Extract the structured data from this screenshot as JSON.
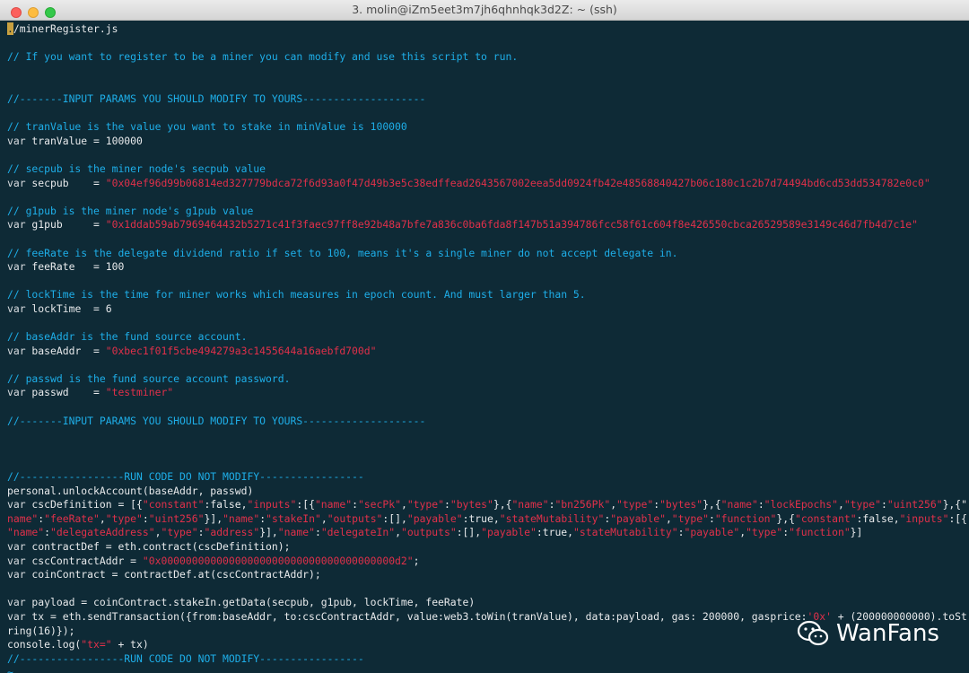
{
  "window": {
    "title": "3. molin@iZm5eet3m7jh6qhnhqk3d2Z: ~ (ssh)",
    "colors": {
      "background": "#0e2a36",
      "comment": "#1eaee8",
      "string": "#e0304a",
      "text": "#e8eaec",
      "cursor": "#c8a040"
    }
  },
  "terminal": {
    "lines": [
      {
        "type": "cursor-line",
        "cursor_char": ".",
        "text": "/minerRegister.js"
      },
      {
        "type": "blank"
      },
      {
        "type": "comment",
        "text": "// If you want to register to be a miner you can modify and use this script to run."
      },
      {
        "type": "blank"
      },
      {
        "type": "blank"
      },
      {
        "type": "comment",
        "text": "//-------INPUT PARAMS YOU SHOULD MODIFY TO YOURS--------------------"
      },
      {
        "type": "blank"
      },
      {
        "type": "comment",
        "text": "// tranValue is the value you want to stake in minValue is 100000"
      },
      {
        "type": "code",
        "parts": [
          {
            "k": "var",
            "t": "var"
          },
          {
            "t": " tranValue = 100000"
          }
        ]
      },
      {
        "type": "blank"
      },
      {
        "type": "comment",
        "text": "// secpub is the miner node's secpub value"
      },
      {
        "type": "code",
        "parts": [
          {
            "k": "var",
            "t": "var"
          },
          {
            "t": " secpub    = "
          },
          {
            "k": "str",
            "t": "\"0x04ef96d99b06814ed327779bdca72f6d93a0f47d49b3e5c38edffead2643567002eea5dd0924fb42e48568840427b06c180c1c2b7d74494bd6cd53dd534782e0c0\""
          }
        ]
      },
      {
        "type": "blank"
      },
      {
        "type": "comment",
        "text": "// g1pub is the miner node's g1pub value"
      },
      {
        "type": "code",
        "parts": [
          {
            "k": "var",
            "t": "var"
          },
          {
            "t": " g1pub     = "
          },
          {
            "k": "str",
            "t": "\"0x1ddab59ab7969464432b5271c41f3faec97ff8e92b48a7bfe7a836c0ba6fda8f147b51a394786fcc58f61c604f8e426550cbca26529589e3149c46d7fb4d7c1e\""
          }
        ]
      },
      {
        "type": "blank"
      },
      {
        "type": "comment",
        "text": "// feeRate is the delegate dividend ratio if set to 100, means it's a single miner do not accept delegate in."
      },
      {
        "type": "code",
        "parts": [
          {
            "k": "var",
            "t": "var"
          },
          {
            "t": " feeRate   = 100"
          }
        ]
      },
      {
        "type": "blank"
      },
      {
        "type": "comment",
        "text": "// lockTime is the time for miner works which measures in epoch count. And must larger than 5."
      },
      {
        "type": "code",
        "parts": [
          {
            "k": "var",
            "t": "var"
          },
          {
            "t": " lockTime  = 6"
          }
        ]
      },
      {
        "type": "blank"
      },
      {
        "type": "comment",
        "text": "// baseAddr is the fund source account."
      },
      {
        "type": "code",
        "parts": [
          {
            "k": "var",
            "t": "var"
          },
          {
            "t": " baseAddr  = "
          },
          {
            "k": "str",
            "t": "\"0xbec1f01f5cbe494279a3c1455644a16aebfd700d\""
          }
        ]
      },
      {
        "type": "blank"
      },
      {
        "type": "comment",
        "text": "// passwd is the fund source account password."
      },
      {
        "type": "code",
        "parts": [
          {
            "k": "var",
            "t": "var"
          },
          {
            "t": " passwd    = "
          },
          {
            "k": "str",
            "t": "\"testminer\""
          }
        ]
      },
      {
        "type": "blank"
      },
      {
        "type": "comment",
        "text": "//-------INPUT PARAMS YOU SHOULD MODIFY TO YOURS--------------------"
      },
      {
        "type": "blank"
      },
      {
        "type": "blank"
      },
      {
        "type": "blank"
      },
      {
        "type": "comment",
        "text": "//-----------------RUN CODE DO NOT MODIFY-----------------"
      },
      {
        "type": "code",
        "parts": [
          {
            "t": "personal.unlockAccount(baseAddr, passwd)"
          }
        ]
      },
      {
        "type": "code",
        "parts": [
          {
            "k": "var",
            "t": "var"
          },
          {
            "t": " cscDefinition = [{"
          },
          {
            "k": "str",
            "t": "\"constant\""
          },
          {
            "t": ":false,"
          },
          {
            "k": "str",
            "t": "\"inputs\""
          },
          {
            "t": ":[{"
          },
          {
            "k": "str",
            "t": "\"name\""
          },
          {
            "t": ":"
          },
          {
            "k": "str",
            "t": "\"secPk\""
          },
          {
            "t": ","
          },
          {
            "k": "str",
            "t": "\"type\""
          },
          {
            "t": ":"
          },
          {
            "k": "str",
            "t": "\"bytes\""
          },
          {
            "t": "},{"
          },
          {
            "k": "str",
            "t": "\"name\""
          },
          {
            "t": ":"
          },
          {
            "k": "str",
            "t": "\"bn256Pk\""
          },
          {
            "t": ","
          },
          {
            "k": "str",
            "t": "\"type\""
          },
          {
            "t": ":"
          },
          {
            "k": "str",
            "t": "\"bytes\""
          },
          {
            "t": "},{"
          },
          {
            "k": "str",
            "t": "\"name\""
          },
          {
            "t": ":"
          },
          {
            "k": "str",
            "t": "\"lockEpochs\""
          },
          {
            "t": ","
          },
          {
            "k": "str",
            "t": "\"type\""
          },
          {
            "t": ":"
          },
          {
            "k": "str",
            "t": "\"uint256\""
          },
          {
            "t": "},{\""
          }
        ]
      },
      {
        "type": "code",
        "parts": [
          {
            "k": "str",
            "t": "name\""
          },
          {
            "t": ":"
          },
          {
            "k": "str",
            "t": "\"feeRate\""
          },
          {
            "t": ","
          },
          {
            "k": "str",
            "t": "\"type\""
          },
          {
            "t": ":"
          },
          {
            "k": "str",
            "t": "\"uint256\""
          },
          {
            "t": "}],"
          },
          {
            "k": "str",
            "t": "\"name\""
          },
          {
            "t": ":"
          },
          {
            "k": "str",
            "t": "\"stakeIn\""
          },
          {
            "t": ","
          },
          {
            "k": "str",
            "t": "\"outputs\""
          },
          {
            "t": ":[],"
          },
          {
            "k": "str",
            "t": "\"payable\""
          },
          {
            "t": ":true,"
          },
          {
            "k": "str",
            "t": "\"stateMutability\""
          },
          {
            "t": ":"
          },
          {
            "k": "str",
            "t": "\"payable\""
          },
          {
            "t": ","
          },
          {
            "k": "str",
            "t": "\"type\""
          },
          {
            "t": ":"
          },
          {
            "k": "str",
            "t": "\"function\""
          },
          {
            "t": "},{"
          },
          {
            "k": "str",
            "t": "\"constant\""
          },
          {
            "t": ":false,"
          },
          {
            "k": "str",
            "t": "\"inputs\""
          },
          {
            "t": ":[{"
          }
        ]
      },
      {
        "type": "code",
        "parts": [
          {
            "k": "str",
            "t": "\"name\""
          },
          {
            "t": ":"
          },
          {
            "k": "str",
            "t": "\"delegateAddress\""
          },
          {
            "t": ","
          },
          {
            "k": "str",
            "t": "\"type\""
          },
          {
            "t": ":"
          },
          {
            "k": "str",
            "t": "\"address\""
          },
          {
            "t": "}],"
          },
          {
            "k": "str",
            "t": "\"name\""
          },
          {
            "t": ":"
          },
          {
            "k": "str",
            "t": "\"delegateIn\""
          },
          {
            "t": ","
          },
          {
            "k": "str",
            "t": "\"outputs\""
          },
          {
            "t": ":[],"
          },
          {
            "k": "str",
            "t": "\"payable\""
          },
          {
            "t": ":true,"
          },
          {
            "k": "str",
            "t": "\"stateMutability\""
          },
          {
            "t": ":"
          },
          {
            "k": "str",
            "t": "\"payable\""
          },
          {
            "t": ","
          },
          {
            "k": "str",
            "t": "\"type\""
          },
          {
            "t": ":"
          },
          {
            "k": "str",
            "t": "\"function\""
          },
          {
            "t": "}]"
          }
        ]
      },
      {
        "type": "code",
        "parts": [
          {
            "k": "var",
            "t": "var"
          },
          {
            "t": " contractDef = eth.contract(cscDefinition);"
          }
        ]
      },
      {
        "type": "code",
        "parts": [
          {
            "k": "var",
            "t": "var"
          },
          {
            "t": " cscContractAddr = "
          },
          {
            "k": "str",
            "t": "\"0x00000000000000000000000000000000000000d2\""
          },
          {
            "t": ";"
          }
        ]
      },
      {
        "type": "code",
        "parts": [
          {
            "k": "var",
            "t": "var"
          },
          {
            "t": " coinContract = contractDef.at(cscContractAddr);"
          }
        ]
      },
      {
        "type": "blank"
      },
      {
        "type": "code",
        "parts": [
          {
            "k": "var",
            "t": "var"
          },
          {
            "t": " payload = coinContract.stakeIn.getData(secpub, g1pub, lockTime, feeRate)"
          }
        ]
      },
      {
        "type": "code",
        "parts": [
          {
            "k": "var",
            "t": "var"
          },
          {
            "t": " tx = eth.sendTransaction({from:baseAddr, to:cscContractAddr, value:web3.toWin(tranValue), data:payload, gas: 200000, gasprice:"
          },
          {
            "k": "str",
            "t": "'0x'"
          },
          {
            "t": " + (200000000000).toSt"
          }
        ]
      },
      {
        "type": "code",
        "parts": [
          {
            "t": "ring(16)});"
          }
        ]
      },
      {
        "type": "code",
        "parts": [
          {
            "t": "console.log("
          },
          {
            "k": "str",
            "t": "\"tx=\""
          },
          {
            "t": " + tx)"
          }
        ]
      },
      {
        "type": "comment",
        "text": "//-----------------RUN CODE DO NOT MODIFY-----------------"
      },
      {
        "type": "tilde",
        "text": "~"
      }
    ]
  },
  "watermark": {
    "text": "WanFans",
    "icon": "wechat-icon"
  }
}
